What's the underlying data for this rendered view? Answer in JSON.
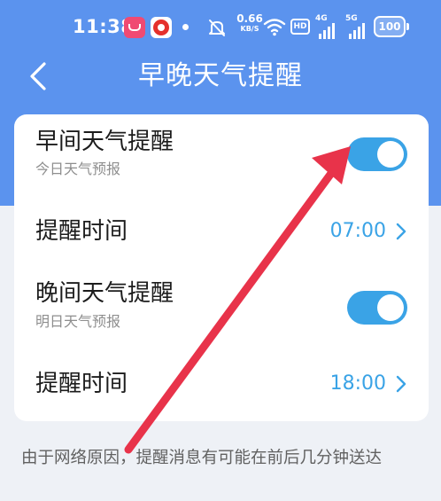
{
  "status_bar": {
    "time": "11:38",
    "net_speed_value": "0.66",
    "net_speed_unit": "KB/S",
    "hd_label": "HD",
    "signal_1_gen": "4G",
    "signal_2_gen": "5G",
    "battery_level": "100",
    "icons": [
      "app-pink-icon",
      "app-red-icon",
      "notification-dot",
      "mute-icon",
      "wifi-icon",
      "hd-icon",
      "signal-icon",
      "signal-icon",
      "battery-icon"
    ]
  },
  "header": {
    "title": "早晚天气提醒",
    "back_icon": "chevron-left-icon"
  },
  "settings": {
    "morning_title": "早间天气提醒",
    "morning_subtitle": "今日天气预报",
    "morning_enabled": true,
    "morning_time_label": "提醒时间",
    "morning_time_value": "07:00",
    "evening_title": "晚间天气提醒",
    "evening_subtitle": "明日天气预报",
    "evening_enabled": true,
    "evening_time_label": "提醒时间",
    "evening_time_value": "18:00"
  },
  "footer": {
    "note": "由于网络原因，提醒消息有可能在前后几分钟送达"
  },
  "colors": {
    "header_blue": "#5b93ee",
    "accent_blue": "#3aa3e6",
    "annotation_red": "#e8334a"
  }
}
